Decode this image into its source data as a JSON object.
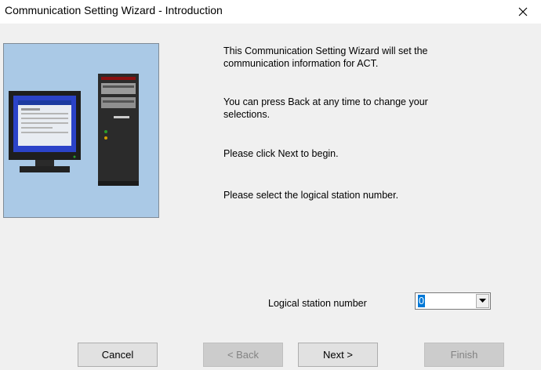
{
  "window": {
    "title": "Communication Setting Wizard - Introduction"
  },
  "content": {
    "para1": "This Communication Setting Wizard will set the communication information for ACT.",
    "para2": "You can press Back at any time to change your selections.",
    "para3": "Please click Next to begin.",
    "para4": "Please select the logical station number."
  },
  "form": {
    "logical_station_label": "Logical station number",
    "logical_station_value": "0"
  },
  "buttons": {
    "cancel": "Cancel",
    "back": "< Back",
    "next": "Next >",
    "finish": "Finish"
  },
  "icons": {
    "close": "close-icon",
    "dropdown": "chevron-down-icon",
    "illustration": "computer-illustration"
  }
}
